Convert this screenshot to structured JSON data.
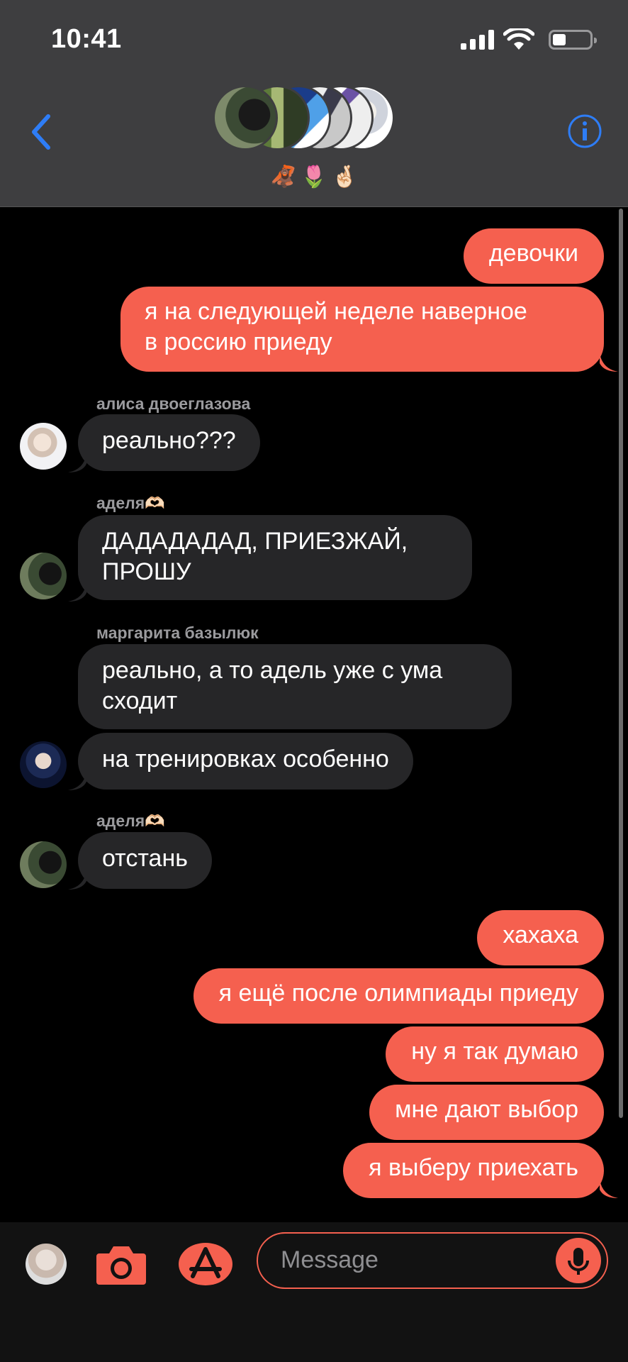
{
  "status_bar": {
    "time": "10:41"
  },
  "group": {
    "emoji": [
      "🦧",
      "🌷",
      "🤞🏻"
    ]
  },
  "colors": {
    "outgoing": "#f5604f",
    "incoming": "#262628",
    "header": "#3e3e40",
    "accent": "#2e7df6"
  },
  "messages": [
    {
      "text": "девочки"
    },
    {
      "line1": "я на следующей неделе наверное",
      "line2": "в россию приеду"
    },
    {
      "sender": "алиса двоеглазова",
      "text": "реально???"
    },
    {
      "sender": "аделя🫶🏻",
      "line1": "ДАДАДАДАД, ПРИЕЗЖАЙ,",
      "line2": "ПРОШУ"
    },
    {
      "sender": "маргарита базылюк",
      "line1": "реально, а то адель уже с ума",
      "line2": "сходит"
    },
    {
      "text": "на тренировках особенно"
    },
    {
      "sender": "аделя🫶🏻",
      "text": "отстань"
    },
    {
      "text": "хахаха"
    },
    {
      "text": "я ещё после олимпиады приеду"
    },
    {
      "text": "ну я так думаю"
    },
    {
      "text": "мне дают выбор"
    },
    {
      "text": "я выберу приехать"
    }
  ],
  "composer": {
    "placeholder": "Message"
  }
}
